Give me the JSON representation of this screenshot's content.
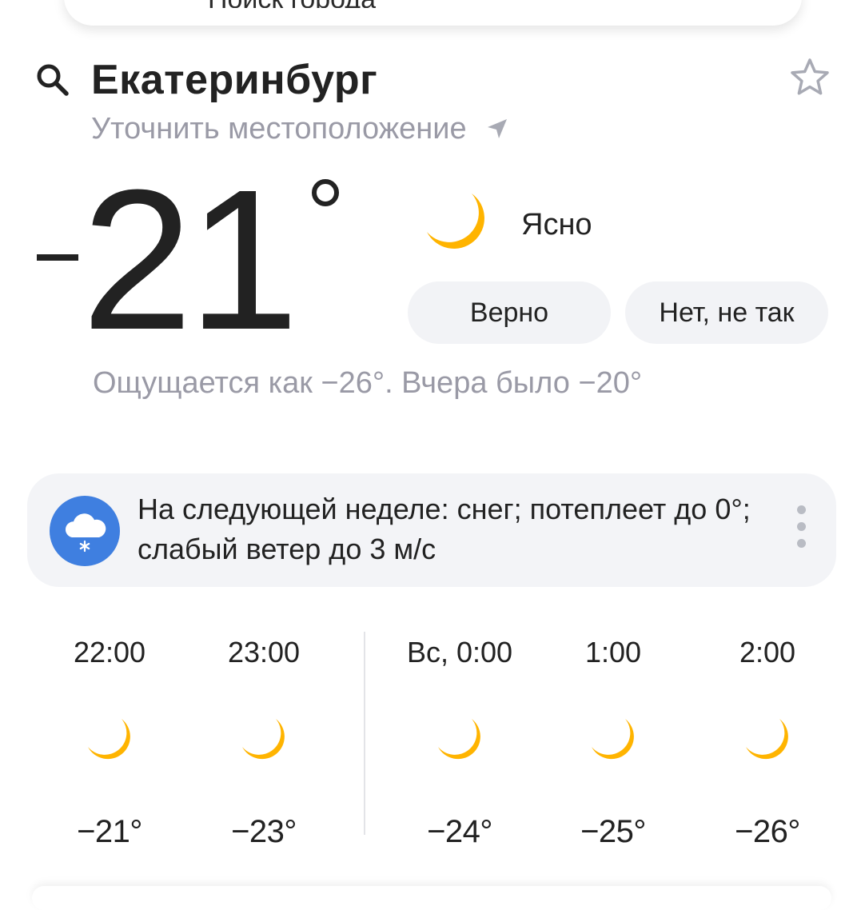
{
  "top_card": {
    "partial_text": "Поиск города"
  },
  "header": {
    "city": "Екатеринбург",
    "refine_location": "Уточнить местоположение"
  },
  "current": {
    "temperature": "21",
    "temperature_sign": "−",
    "condition": "Ясно",
    "feedback_yes": "Верно",
    "feedback_no": "Нет, не так",
    "feels_like": "Ощущается как −26°. Вчера было −20°"
  },
  "alert": {
    "text": "На следующей неделе: снег; потеплеет до 0°; слабый ветер до 3 м/с"
  },
  "hourly": [
    {
      "time": "22:00",
      "icon": "moon-icon",
      "temp": "−21°"
    },
    {
      "time": "23:00",
      "icon": "moon-icon",
      "temp": "−23°"
    },
    {
      "time": "Вс, 0:00",
      "icon": "moon-icon",
      "temp": "−24°"
    },
    {
      "time": "1:00",
      "icon": "moon-icon",
      "temp": "−25°"
    },
    {
      "time": "2:00",
      "icon": "moon-icon",
      "temp": "−26°"
    }
  ],
  "colors": {
    "moon": "#ffb400",
    "alert_icon_bg": "#3f7fe0",
    "muted_text": "#9a9aa6",
    "pill_bg": "#f2f3f6"
  }
}
